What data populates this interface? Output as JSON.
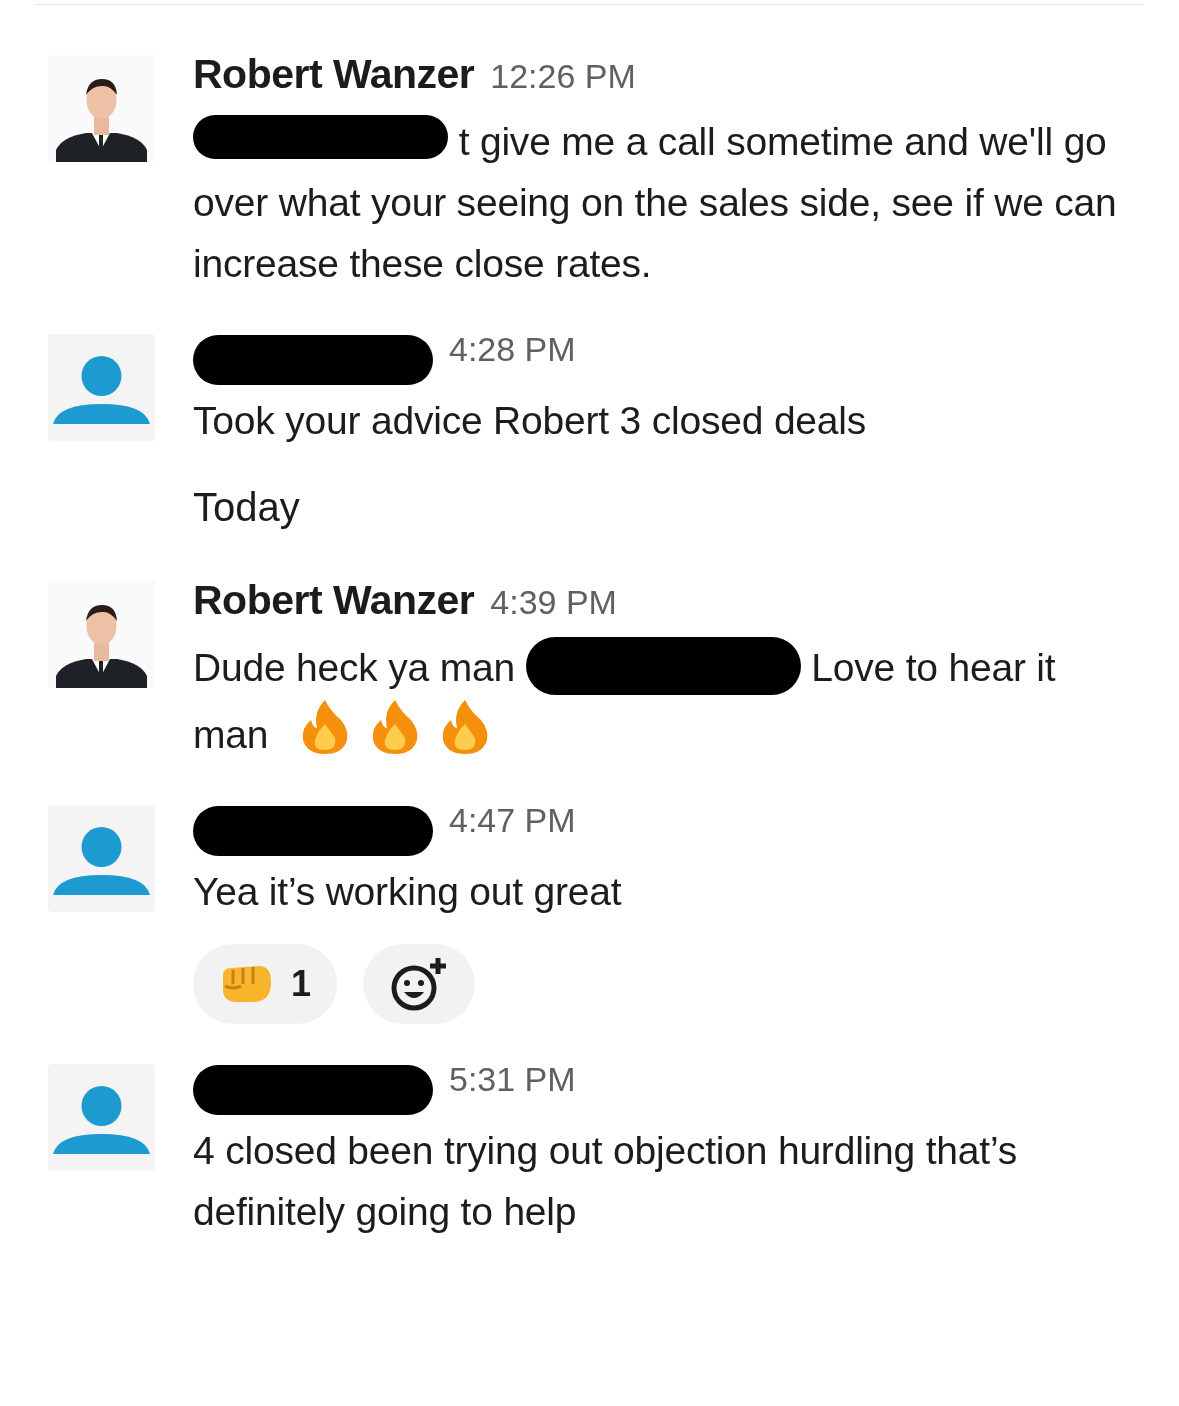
{
  "messages": [
    {
      "author": "Robert Wanzer",
      "name_redacted": false,
      "time": "12:26 PM",
      "body": [
        {
          "kind": "redaction"
        },
        {
          "kind": "text",
          "text": "t give me a call sometime and we'll go over what your seeing on the sales side, see if we can increase these close rates."
        }
      ]
    },
    {
      "avatar": {
        "kind": "default"
      },
      "name_redacted": true,
      "time": "4:28 PM",
      "body": [
        {
          "kind": "text",
          "text": "Took your advice Robert 3 closed deals"
        }
      ],
      "divider_after": "Today"
    },
    {
      "author": "Robert Wanzer",
      "name_redacted": false,
      "time": "4:39 PM",
      "body": [
        {
          "kind": "text",
          "text": "Dude heck ya man"
        },
        {
          "kind": "redaction"
        },
        {
          "kind": "text",
          "text": "Love to hear it man"
        },
        {
          "kind": "fire"
        },
        {
          "kind": "fire"
        },
        {
          "kind": "fire"
        }
      ]
    },
    {
      "avatar": {
        "kind": "default"
      },
      "name_redacted": true,
      "time": "4:47 PM",
      "body": [
        {
          "kind": "text",
          "text": "Yea it’s working out great"
        }
      ],
      "reactions": [
        {
          "kind": "fist",
          "count": "1"
        }
      ],
      "add_reaction": true
    },
    {
      "avatar": {
        "kind": "default"
      },
      "name_redacted": true,
      "time": "5:31 PM",
      "body": [
        {
          "kind": "text",
          "text": "4 closed been trying out objection hurdling that’s definitely going to help"
        }
      ]
    }
  ]
}
